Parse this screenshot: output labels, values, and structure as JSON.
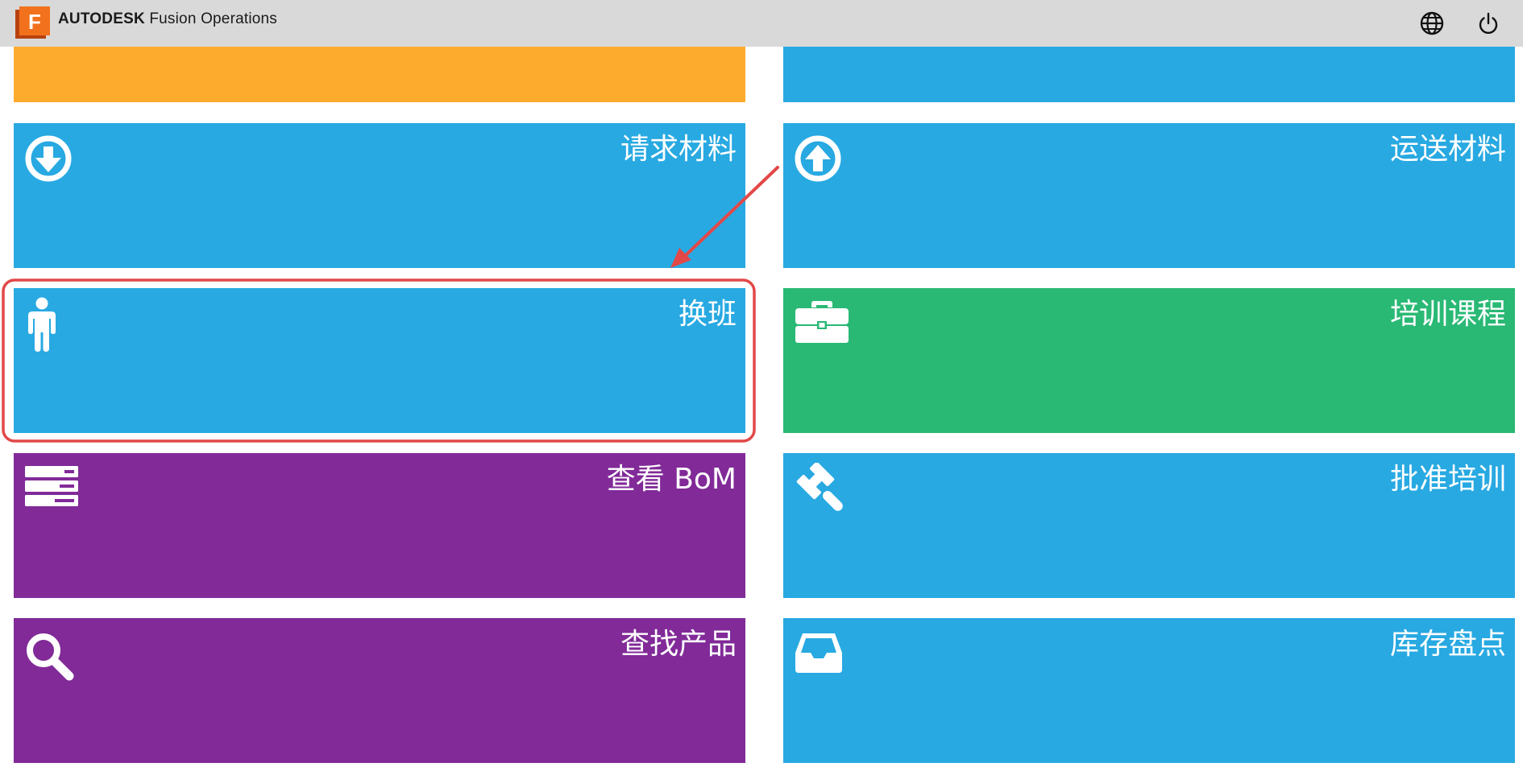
{
  "header": {
    "brand": "AUTODESK",
    "product": "Fusion Operations",
    "logo_letter": "F",
    "icons": [
      "globe-icon",
      "power-icon"
    ]
  },
  "colors": {
    "blue": "#28a9e2",
    "orange": "#fdab2d",
    "green": "#29b975",
    "purple": "#812a98",
    "highlight": "#e24848"
  },
  "tiles": {
    "top_left": {
      "label": "",
      "color": "#fdab2d"
    },
    "top_right": {
      "label": "",
      "color": "#28a9e2"
    },
    "request_material": {
      "label": "请求材料",
      "icon": "arrow-down-circle-icon",
      "color": "#28a9e2"
    },
    "ship_material": {
      "label": "运送材料",
      "icon": "arrow-up-circle-icon",
      "color": "#28a9e2"
    },
    "shift_change": {
      "label": "换班",
      "icon": "person-icon",
      "color": "#28a9e2",
      "highlighted": true
    },
    "training_course": {
      "label": "培训课程",
      "icon": "briefcase-icon",
      "color": "#29b975"
    },
    "view_bom": {
      "label": "查看 BoM",
      "icon": "server-list-icon",
      "color": "#812a98"
    },
    "approve_training": {
      "label": "批准培训",
      "icon": "gavel-icon",
      "color": "#28a9e2"
    },
    "find_product": {
      "label": "查找产品",
      "icon": "search-icon",
      "color": "#812a98"
    },
    "inventory_count": {
      "label": "库存盘点",
      "icon": "inbox-tray-icon",
      "color": "#28a9e2"
    }
  }
}
